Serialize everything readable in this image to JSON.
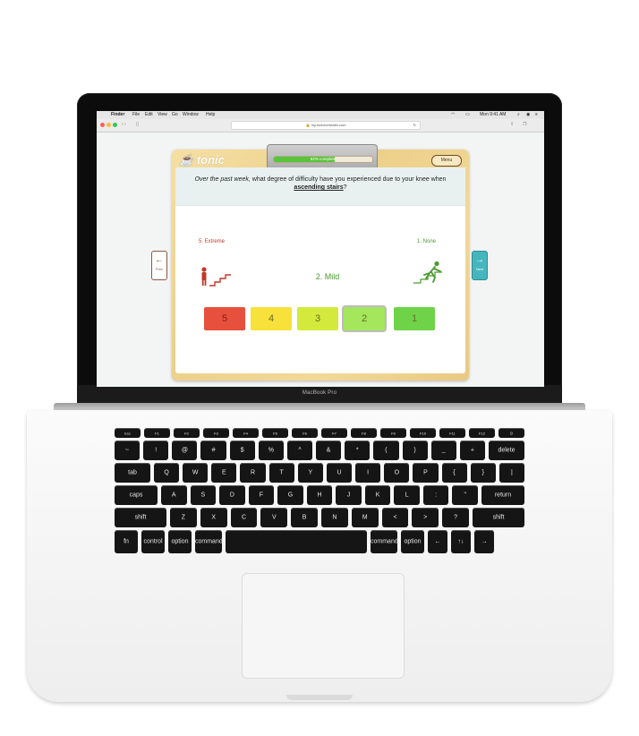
{
  "laptop": {
    "brand": "MacBook Pro"
  },
  "menubar": {
    "app": "Finder",
    "items": [
      "File",
      "Edit",
      "View",
      "Go",
      "Window",
      "Help"
    ],
    "clock": "Mon 9:41 AM"
  },
  "browser": {
    "url": "my.tonicforhealth.com"
  },
  "app": {
    "logo": "tonic",
    "progress": {
      "label": "62% complete",
      "value": 62
    },
    "menu_label": "Menu",
    "question": {
      "prefix_em": "Over the past week,",
      "middle": " what degree of difficulty have you experienced due to your knee when ",
      "emph": "ascending stairs",
      "suffix": "?"
    },
    "scale": {
      "left_label": "5. Extreme",
      "right_label": "1. None",
      "selected_label": "2. Mild",
      "options": [
        {
          "label": "5",
          "color": "#e8503e"
        },
        {
          "label": "4",
          "color": "#f7e13a"
        },
        {
          "label": "3",
          "color": "#d3ea3c"
        },
        {
          "label": "2",
          "color": "#a4e65c"
        },
        {
          "label": "1",
          "color": "#6fd34a"
        }
      ],
      "selected": "2"
    },
    "nav": {
      "prev": "Prev",
      "next": "Next"
    }
  },
  "keyboard": {
    "row1": [
      "Esc",
      "F1",
      "F2",
      "F3",
      "F4",
      "F5",
      "F6",
      "F7",
      "F8",
      "F9",
      "F10",
      "F11",
      "F12",
      "⏻"
    ],
    "row2": [
      "~",
      "!",
      "@",
      "#",
      "$",
      "%",
      "^",
      "&",
      "*",
      "(",
      ")",
      "_",
      "+",
      "delete"
    ],
    "row3": [
      "tab",
      "Q",
      "W",
      "E",
      "R",
      "T",
      "Y",
      "U",
      "I",
      "O",
      "P",
      "{",
      "}",
      "|"
    ],
    "row4": [
      "caps",
      "A",
      "S",
      "D",
      "F",
      "G",
      "H",
      "J",
      "K",
      "L",
      ":",
      "\"",
      "return"
    ],
    "row5": [
      "shift",
      "Z",
      "X",
      "C",
      "V",
      "B",
      "N",
      "M",
      "<",
      ">",
      "?",
      "shift"
    ],
    "row6": [
      "fn",
      "control",
      "option",
      "command",
      "",
      "command",
      "option",
      "←",
      "↑↓",
      "→"
    ]
  }
}
